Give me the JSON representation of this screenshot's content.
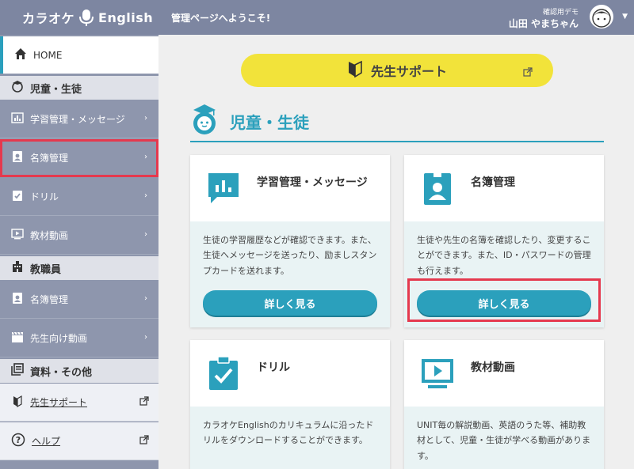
{
  "app": {
    "logo_left": "カラオケ",
    "logo_right": "English"
  },
  "header": {
    "welcome": "管理ページへようこそ!",
    "user_sub": "確認用デモ",
    "user_name": "山田 やまちゃん"
  },
  "sidebar": {
    "home": "HOME",
    "sections": [
      {
        "title": "児童・生徒",
        "items": [
          "学習管理・メッセージ",
          "名簿管理",
          "ドリル",
          "教材動画"
        ]
      },
      {
        "title": "教職員",
        "items": [
          "名簿管理",
          "先生向け動画"
        ]
      },
      {
        "title": "資料・その他",
        "items": [
          "先生サポート",
          "ヘルプ"
        ]
      }
    ]
  },
  "main": {
    "support_button": "先生サポート",
    "section_title": "児童・生徒",
    "cards": [
      {
        "title": "学習管理・メッセージ",
        "desc": "生徒の学習履歴などが確認できます。また、生徒へメッセージを送ったり、励ましスタンプカードを送れます。",
        "button": "詳しく見る"
      },
      {
        "title": "名簿管理",
        "desc": "生徒や先生の名簿を確認したり、変更することができます。また、ID・パスワードの管理も行えます。",
        "button": "詳しく見る"
      },
      {
        "title": "ドリル",
        "desc": "カラオケEnglishのカリキュラムに沿ったドリルをダウンロードすることができます。"
      },
      {
        "title": "教材動画",
        "desc": "UNIT毎の解説動画、英語のうた等、補助教材として、児童・生徒が学べる動画があります。"
      }
    ]
  },
  "colors": {
    "accent": "#2ba0bc",
    "sidebar": "#8e96ad",
    "highlight": "#e5394e",
    "support": "#f2e33a"
  }
}
